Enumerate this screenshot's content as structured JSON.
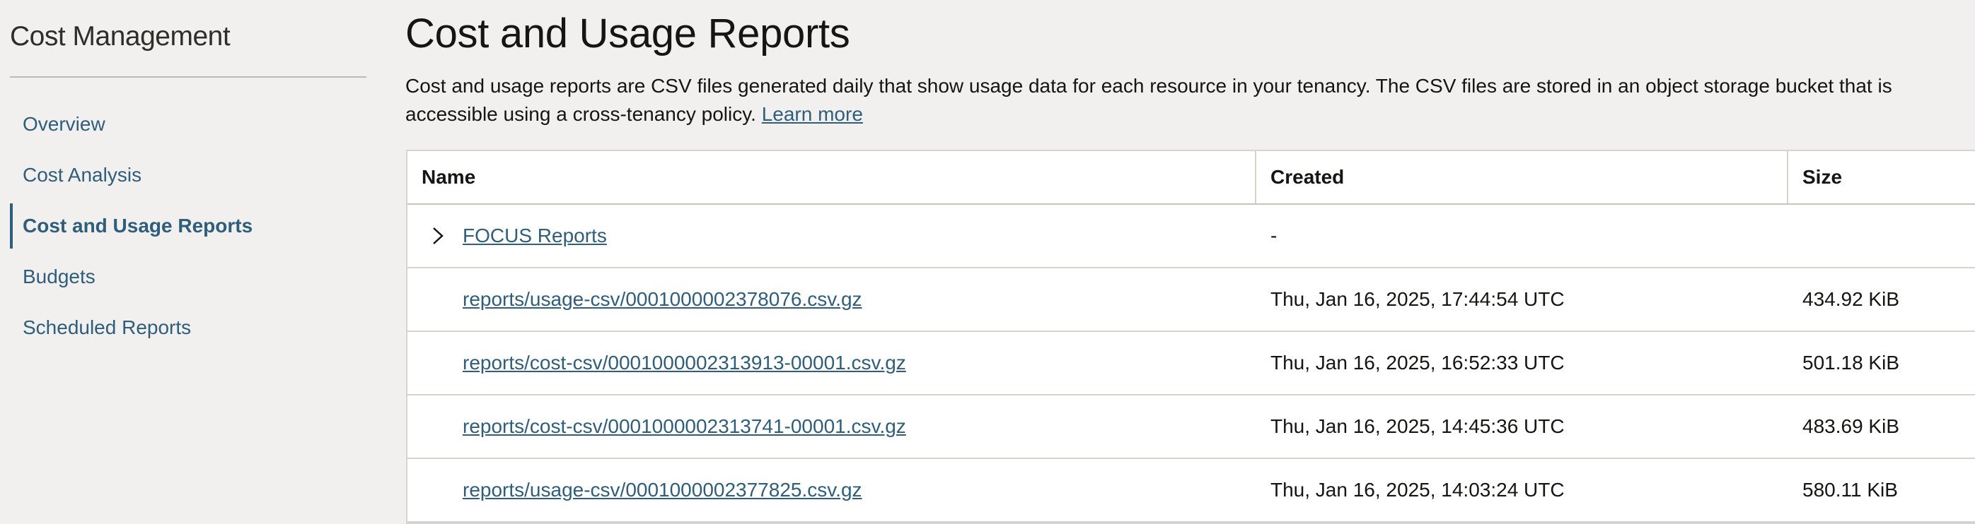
{
  "sidebar": {
    "title": "Cost Management",
    "items": [
      {
        "label": "Overview"
      },
      {
        "label": "Cost Analysis"
      },
      {
        "label": "Cost and Usage Reports"
      },
      {
        "label": "Budgets"
      },
      {
        "label": "Scheduled Reports"
      }
    ],
    "active_index": 2
  },
  "main": {
    "title": "Cost and Usage Reports",
    "description": "Cost and usage reports are CSV files generated daily that show usage data for each resource in your tenancy. The CSV files are stored in an object storage bucket that is accessible using a cross-tenancy policy.",
    "learn_more": "Learn more"
  },
  "table": {
    "headers": {
      "name": "Name",
      "created": "Created",
      "size": "Size"
    },
    "rows": [
      {
        "name": "FOCUS Reports",
        "created": "-",
        "size": "",
        "expandable": true
      },
      {
        "name": "reports/usage-csv/0001000002378076.csv.gz",
        "created": "Thu, Jan 16, 2025, 17:44:54 UTC",
        "size": "434.92 KiB"
      },
      {
        "name": "reports/cost-csv/0001000002313913-00001.csv.gz",
        "created": "Thu, Jan 16, 2025, 16:52:33 UTC",
        "size": "501.18 KiB"
      },
      {
        "name": "reports/cost-csv/0001000002313741-00001.csv.gz",
        "created": "Thu, Jan 16, 2025, 14:45:36 UTC",
        "size": "483.69 KiB"
      },
      {
        "name": "reports/usage-csv/0001000002377825.csv.gz",
        "created": "Thu, Jan 16, 2025, 14:03:24 UTC",
        "size": "580.11 KiB"
      }
    ]
  },
  "colors": {
    "link": "#2f5e7d",
    "background": "#f1f0ee",
    "text": "#161513"
  }
}
